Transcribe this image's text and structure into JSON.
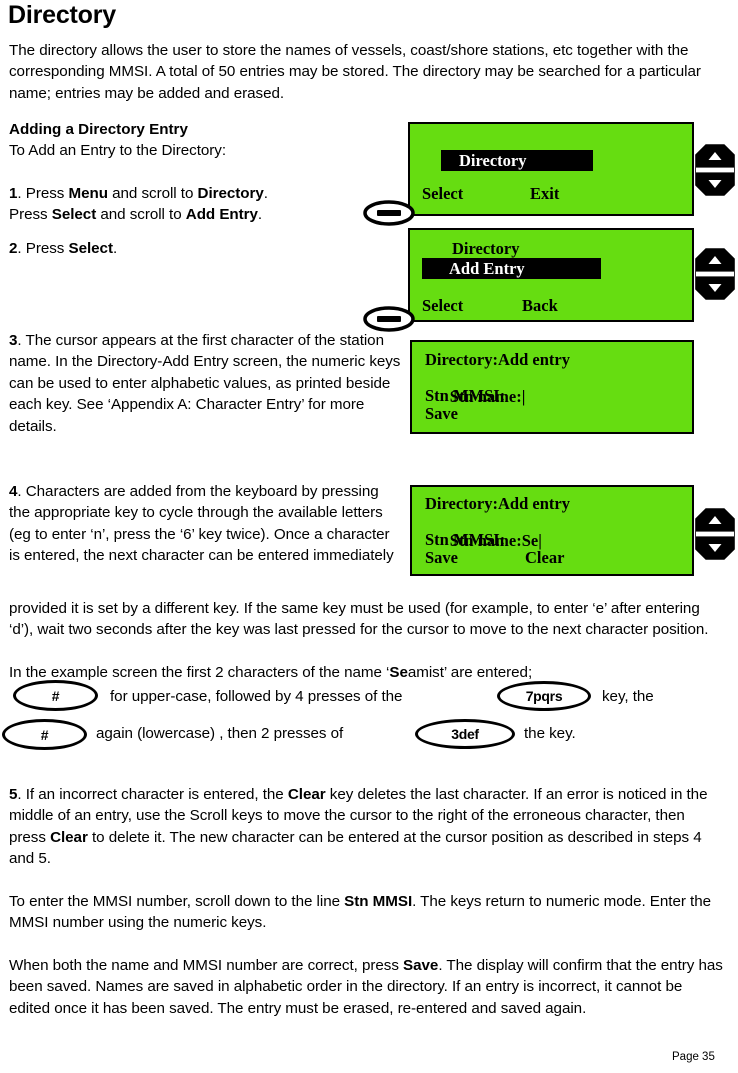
{
  "document": {
    "title": "Directory",
    "intro": "The directory allows the user to store the names of vessels, coast/shore stations, etc  together with the corresponding MMSI. A total of 50 entries may be stored. The directory may be searched for a particular name; entries may be added and erased.",
    "page_number": "Page 35"
  },
  "section": {
    "heading": "Adding a Directory Entry",
    "subheading": "To Add an Entry to the Directory:"
  },
  "steps": {
    "step1_num": "1",
    "step1_a_pre": ". Press ",
    "step1_a_b1": "Menu",
    "step1_a_mid": " and scroll to ",
    "step1_a_b2": "Directory",
    "step1_a_post": ".",
    "step1_b_pre": "Press ",
    "step1_b_b1": "Select",
    "step1_b_mid": " and scroll to ",
    "step1_b_b2": "Add Entry",
    "step1_b_post": ".",
    "step2_num": "2",
    "step2_pre": ". Press ",
    "step2_b1": "Select",
    "step2_post": ".",
    "step3_num": "3",
    "step3_text": ". The cursor appears at the first character of the station name. In the Directory-Add Entry screen, the numeric keys can be used to enter alphabetic values, as printed beside each key. See ‘Appendix A: Character Entry’ for more details.",
    "step4_num": "4",
    "step4_text_col": ". Characters are added from the keyboard by pressing the appropriate key to cycle through the available letters (eg to enter ‘n’, press the ‘6’ key twice). Once a character is entered, the next character can be entered immediately",
    "step4_text_full": "provided it is set by a different key. If the same key must be used (for example, to enter ‘e’ after entering ‘d’), wait two seconds after the key was last pressed for the cursor to move to the next character position.",
    "example_pre": "In the example screen the first 2 characters of the name ‘",
    "example_bold": "Se",
    "example_post": "amist’ are entered;",
    "example_line2_a": "for upper-case, followed by 4 presses of the",
    "example_line2_b": "key, the",
    "example_line3_a": "again (lowercase) , then 2 presses of",
    "example_line3_b": "the key.",
    "step5_num": "5",
    "step5_a": ". If an incorrect character is entered, the ",
    "step5_b1": "Clear",
    "step5_b": " key deletes the last character. If an error is noticed in the middle of an entry, use the Scroll keys to move the cursor to the right of the erroneous character, then press ",
    "step5_b2": "Clear",
    "step5_c": " to delete it. The new character can be entered at the cursor position as described in steps 4 and 5.",
    "mmsi_a": "To enter the MMSI number, scroll down to the line ",
    "mmsi_b1": "Stn MMSI",
    "mmsi_b": ". The keys return to numeric mode. Enter the MMSI number using the numeric keys.",
    "save_a": "When both the name and MMSI number are correct, press ",
    "save_b1": "Save",
    "save_b": ". The display will confirm that the entry has been saved. Names are saved in alphabetic order in the directory. If an entry is incorrect, it cannot be edited once it has been saved. The entry must be erased, re-entered and saved again."
  },
  "keycaps": {
    "hash1": "#",
    "key7": "7pqrs",
    "hash2": "#",
    "key3": "3def"
  },
  "lcd_screens": [
    {
      "id": "lcd-directory-select",
      "highlight": "Directory",
      "softkey_left": "Select",
      "softkey_right": "Exit"
    },
    {
      "id": "lcd-directory-add-entry",
      "title": "Directory",
      "highlight": "Add Entry",
      "softkey_left": "Select",
      "softkey_right": "Back"
    },
    {
      "id": "lcd-add-entry-empty",
      "line1": "Directory:Add entry",
      "line2": "Stn name:",
      "cursor": "|",
      "line3": "Stn MMSI:",
      "line4": "Save"
    },
    {
      "id": "lcd-add-entry-se",
      "line1": "Directory:Add entry",
      "line2": "Stn name:Se",
      "cursor": "|",
      "line3": "Stn MMSI:",
      "line4_left": "Save",
      "line4_right": "Clear"
    }
  ],
  "colors": {
    "lcd_background": "#66dd11",
    "lcd_text": "#000000",
    "lcd_highlight_bg": "#000000",
    "lcd_highlight_text": "#ffffff"
  }
}
